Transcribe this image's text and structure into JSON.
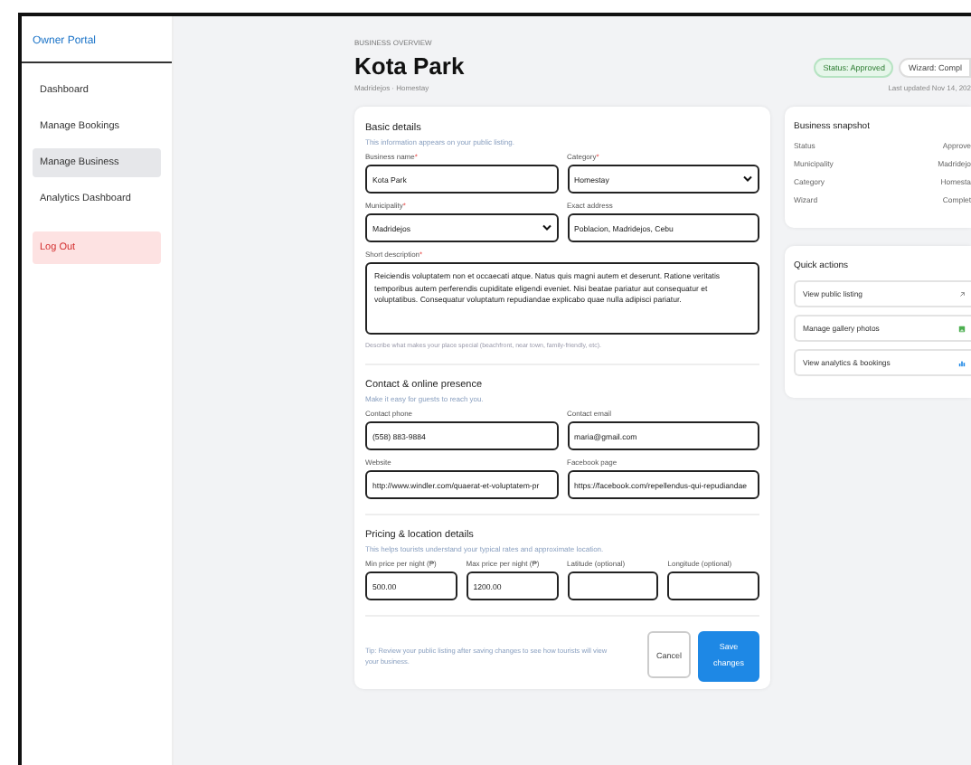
{
  "sidebar": {
    "brand": "Owner Portal",
    "items": [
      {
        "label": "Dashboard",
        "selected": false
      },
      {
        "label": "Manage Bookings",
        "selected": false
      },
      {
        "label": "Manage Business",
        "selected": true
      },
      {
        "label": "Analytics Dashboard",
        "selected": false
      }
    ],
    "logout": "Log Out"
  },
  "header": {
    "eyebrow": "BUSINESS OVERVIEW",
    "title": "Kota Park",
    "subtitle": "Madridejos · Homestay",
    "badges": [
      {
        "label": "Status: Approved",
        "kind": "success"
      },
      {
        "label": "Wizard: Compl",
        "kind": "neutral"
      }
    ],
    "updated": "Last updated Nov 14, 202"
  },
  "form": {
    "sections": [
      {
        "title": "Basic details",
        "subtitle": "This information appears on your public listing.",
        "kind": "pairs",
        "fields": [
          {
            "label": "Business name",
            "marker": "*",
            "kind": "text",
            "value": "Kota Park"
          },
          {
            "label": "Category",
            "marker": "*",
            "kind": "select",
            "value": "Homestay"
          },
          {
            "label": "Municipality",
            "marker": "*",
            "kind": "select",
            "value": "Madridejos"
          },
          {
            "label": "Exact address",
            "kind": "text",
            "value": "Poblacion, Madridejos, Cebu"
          },
          {
            "label": "Short description",
            "marker": "*",
            "kind": "textarea",
            "value": "Reiciendis voluptatem non et occaecati atque. Natus quis magni autem et deserunt. Ratione veritatis temporibus autem perferendis cupiditate eligendi eveniet. Nisi beatae pariatur aut consequatur et voluptatibus. Consequatur voluptatum repudiandae explicabo quae nulla adipisci pariatur.",
            "hint": "Describe what makes your place special (beachfront, near town, family-friendly, etc)."
          }
        ]
      },
      {
        "title": "Contact & online presence",
        "subtitle": "Make it easy for guests to reach you.",
        "kind": "pairs",
        "fields": [
          {
            "label": "Contact phone",
            "kind": "text",
            "value": "(558) 883-9884"
          },
          {
            "label": "Contact email",
            "kind": "text",
            "value": "maria@gmail.com"
          },
          {
            "label": "Website",
            "kind": "text",
            "value": "http://www.windler.com/quaerat-et-voluptatem-pr"
          },
          {
            "label": "Facebook page",
            "kind": "text",
            "value": "https://facebook.com/repellendus-qui-repudiandae"
          }
        ]
      },
      {
        "title": "Pricing & location details",
        "subtitle": "This helps tourists understand your typical rates and approximate location.",
        "kind": "quad",
        "fields": [
          {
            "label": "Min price per night (₱)",
            "kind": "text",
            "value": "500.00"
          },
          {
            "label": "Max price per night (₱)",
            "kind": "text",
            "value": "1200.00"
          },
          {
            "label": "Latitude (optional)",
            "kind": "text"
          },
          {
            "label": "Longitude (optional)",
            "kind": "text"
          }
        ]
      }
    ],
    "tip": "Tip: Review your public listing after saving changes to see how tourists will view your business.",
    "buttons": [
      {
        "label": "Cancel",
        "kind": "secondary"
      },
      {
        "label": "Save changes",
        "kind": "primary"
      }
    ]
  },
  "snapshot": {
    "title": "Business snapshot",
    "rows": [
      {
        "label": "Status",
        "value": "Approve"
      },
      {
        "label": "Municipality",
        "value": "Madridejo"
      },
      {
        "label": "Category",
        "value": "Homesta"
      },
      {
        "label": "Wizard",
        "value": "Complet"
      }
    ]
  },
  "quick_actions": {
    "title": "Quick actions",
    "items": [
      {
        "label": "View public listing",
        "kind": "external"
      },
      {
        "label": "Manage gallery photos",
        "kind": "gallery"
      },
      {
        "label": "View analytics & bookings",
        "kind": "chart"
      }
    ]
  }
}
